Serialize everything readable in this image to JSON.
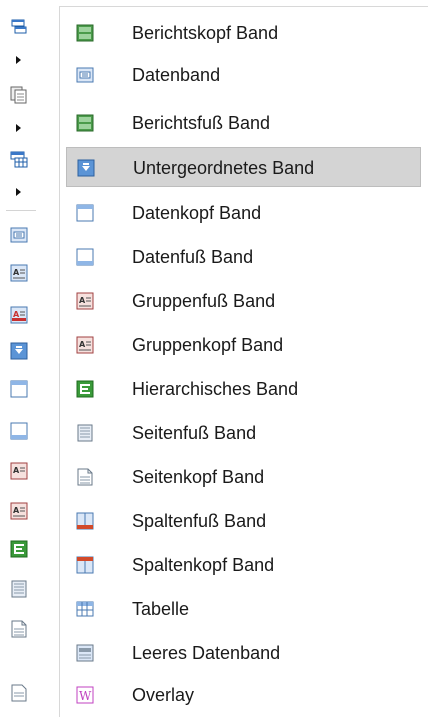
{
  "menu": {
    "items": [
      {
        "label": "Berichtskopf Band",
        "icon": "report-header-band-icon"
      },
      {
        "label": "Datenband",
        "icon": "data-band-icon"
      },
      {
        "label": "Berichtsfuß Band",
        "icon": "report-footer-band-icon"
      },
      {
        "label": "Untergeordnetes Band",
        "icon": "child-band-icon",
        "selected": true
      },
      {
        "label": "Datenkopf Band",
        "icon": "data-header-band-icon"
      },
      {
        "label": "Datenfuß Band",
        "icon": "data-footer-band-icon"
      },
      {
        "label": "Gruppenfuß Band",
        "icon": "group-footer-band-icon"
      },
      {
        "label": "Gruppenkopf Band",
        "icon": "group-header-band-icon"
      },
      {
        "label": "Hierarchisches Band",
        "icon": "hierarchical-band-icon"
      },
      {
        "label": "Seitenfuß Band",
        "icon": "page-footer-band-icon"
      },
      {
        "label": "Seitenkopf Band",
        "icon": "page-header-band-icon"
      },
      {
        "label": "Spaltenfuß Band",
        "icon": "column-footer-band-icon"
      },
      {
        "label": "Spaltenkopf Band",
        "icon": "column-header-band-icon"
      },
      {
        "label": "Tabelle",
        "icon": "table-band-icon"
      },
      {
        "label": "Leeres Datenband",
        "icon": "empty-data-band-icon"
      },
      {
        "label": "Overlay",
        "icon": "overlay-band-icon"
      }
    ]
  },
  "toolbar": {
    "icons": [
      "band-header-icon",
      "band-copy-icon",
      "band-table-icon",
      "data-band-icon",
      "group-header-band-icon",
      "group-footer-band-icon",
      "child-band-icon",
      "data-header-band-icon",
      "data-footer-band-icon",
      "group-header-band-icon",
      "group-footer-band-icon",
      "hierarchical-band-icon",
      "page-footer-band-icon",
      "page-header-band-icon"
    ]
  },
  "colors": {
    "selection_bg": "#d4d4d4",
    "green": "#3a8a3a",
    "blue": "#3a78c8",
    "red": "#c83030"
  }
}
